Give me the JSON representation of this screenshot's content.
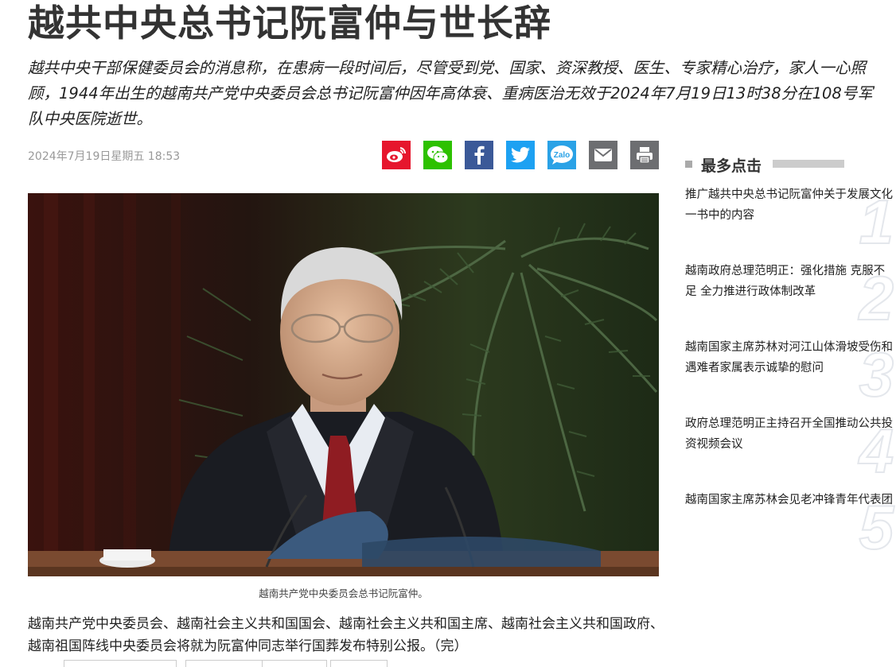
{
  "article": {
    "title": "越共中央总书记阮富仲与世长辞",
    "lede": "越共中央干部保健委员会的消息称，在患病一段时间后，尽管受到党、国家、资深教授、医生、专家精心治疗，家人一心照顾，1944年出生的越南共产党中央委员会总书记阮富仲因年高体衰、重病医治无效于2024年7月19日13时38分在108号军队中央医院逝世。",
    "date": "2024年7月19日星期五 18:53",
    "photo_caption": "越南共产党中央委员会总书记阮富仲。",
    "body": "越南共产党中央委员会、越南社会主义共和国国会、越南社会主义共和国主席、越南社会主义共和国政府、越南祖国阵线中央委员会将就为阮富仲同志举行国葬发布特别公报。（完）"
  },
  "share": [
    {
      "name": "weibo-icon",
      "color": "#e6162d"
    },
    {
      "name": "wechat-icon",
      "color": "#2dc100"
    },
    {
      "name": "facebook-icon",
      "color": "#3b5998"
    },
    {
      "name": "twitter-icon",
      "color": "#1da1f2"
    },
    {
      "name": "zalo-icon",
      "color": "#2aa2e6",
      "label": "Zalo"
    },
    {
      "name": "email-icon",
      "color": "#6d6e71"
    },
    {
      "name": "print-icon",
      "color": "#6d6e71"
    }
  ],
  "sidebar": {
    "heading": "最多点击",
    "items": [
      {
        "rank": "1",
        "title": "推广越共中央总书记阮富仲关于发展文化一书中的内容"
      },
      {
        "rank": "2",
        "title": "越南政府总理范明正：强化措施 克服不足 全力推进行政体制改革"
      },
      {
        "rank": "3",
        "title": "越南国家主席苏林对河江山体滑坡受伤和遇难者家属表示诚挚的慰问"
      },
      {
        "rank": "4",
        "title": "政府总理范明正主持召开全国推动公共投资视频会议"
      },
      {
        "rank": "5",
        "title": "越南国家主席苏林会见老冲锋青年代表团"
      }
    ]
  }
}
